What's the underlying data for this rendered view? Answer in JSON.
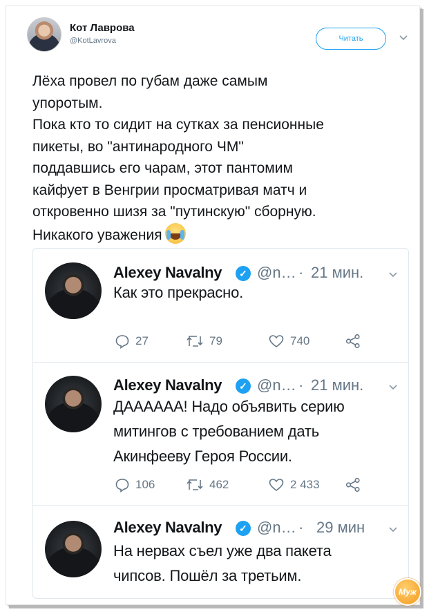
{
  "tweet": {
    "author_name": "Кот Лаврова",
    "author_handle": "@KotLavrova",
    "follow_label": "Читать",
    "text": "Лёха провел по губам даже самым\nупоротым.\nПока кто то сидит на сутках за пенсионные\nпикеты, во \"антинародного ЧМ\"\nподдавшись его чарам,  этот пантомим\nкайфует в Венгрии просматривая матч и\nоткровенно шизя за \"путинскую\" сборную.\nНикакого уважения",
    "emoji": "crying-laughing-emoji"
  },
  "thread": [
    {
      "name": "Alexey Navalny",
      "handle": "@n…",
      "dot": "·",
      "time": "21 мин.",
      "text": "Как это прекрасно.",
      "replies": "27",
      "retweets": "79",
      "likes": "740"
    },
    {
      "name": "Alexey Navalny",
      "handle": "@n…",
      "dot": "·",
      "time": "21 мин.",
      "text": "ДАААААА! Надо объявить серию\nмитингов с требованием дать\nАкинфееву Героя России.",
      "replies": "106",
      "retweets": "462",
      "likes": "2 433"
    },
    {
      "name": "Alexey Navalny",
      "handle": "@n…",
      "dot": "·",
      "time": "29 мин",
      "text": "На нервах съел уже два пакета\nчипсов. Пошёл за третьим."
    }
  ],
  "watermark": "Муж",
  "colors": {
    "accent": "#1da1f2",
    "muted": "#657786",
    "text": "#14171a"
  }
}
